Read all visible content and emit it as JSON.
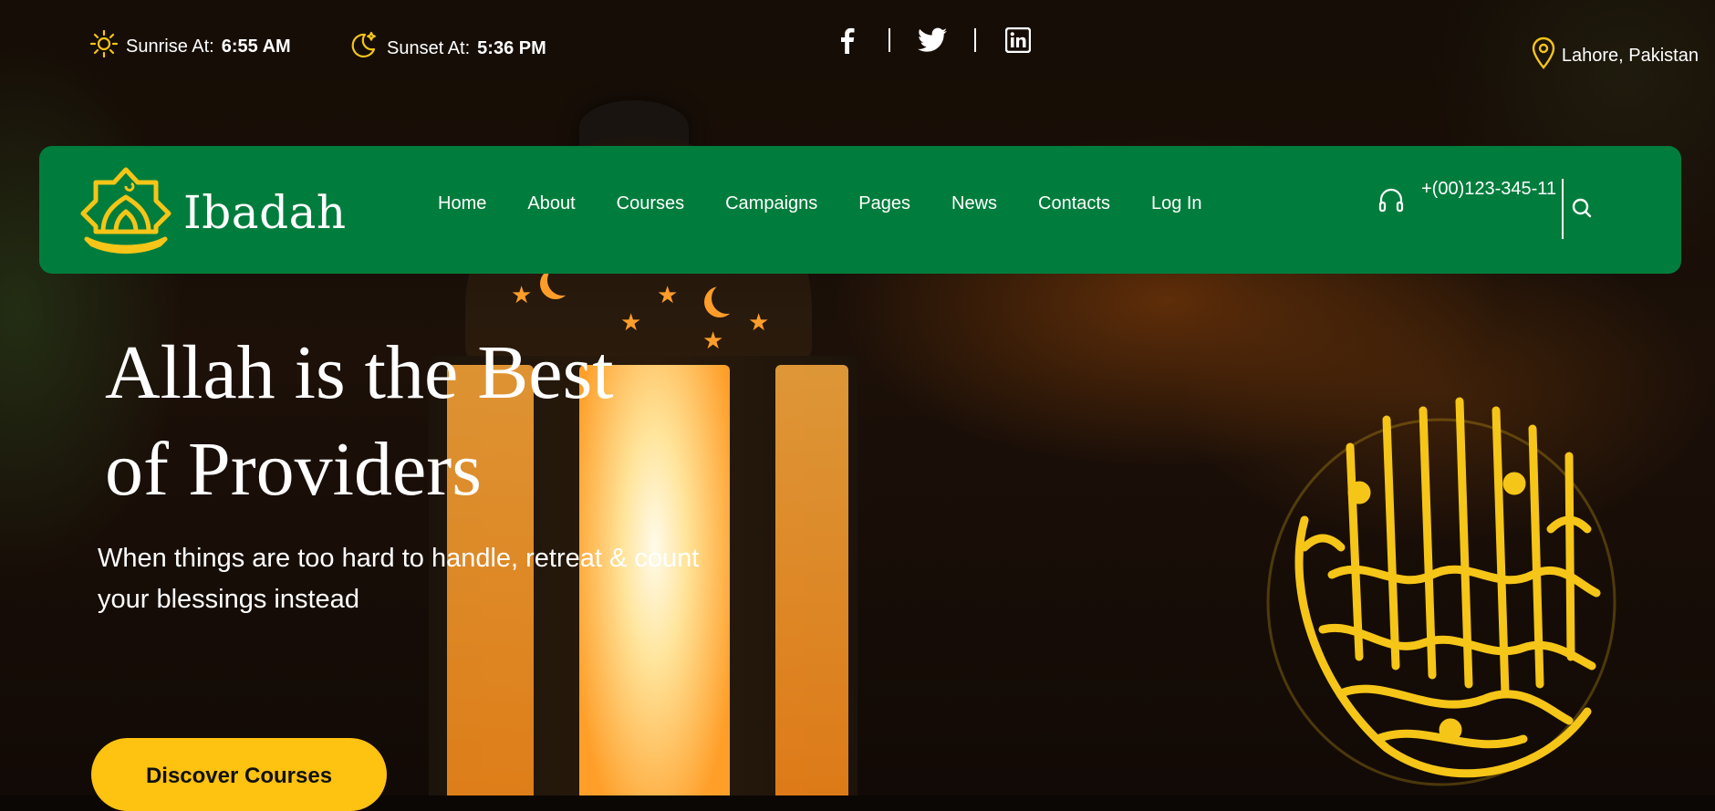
{
  "topbar": {
    "sunrise_label": "Sunrise At:",
    "sunrise_time": "6:55 AM",
    "sunset_label": "Sunset At:",
    "sunset_time": "5:36 PM",
    "social": [
      "facebook-icon",
      "twitter-icon",
      "linkedin-icon"
    ],
    "location": "Lahore, Pakistan"
  },
  "nav": {
    "logo_text": "Ibadah",
    "items": [
      "Home",
      "About",
      "Courses",
      "Campaigns",
      "Pages",
      "News",
      "Contacts",
      "Log In"
    ],
    "phone": "+(00)123-345-11"
  },
  "hero": {
    "title_line1": "Allah is the Best",
    "title_line2": "of Providers",
    "subtitle_line1": "When things are too hard to handle, retreat & count",
    "subtitle_line2": "your blessings instead",
    "cta_label": "Discover Courses"
  },
  "colors": {
    "nav_green": "#007d3c",
    "accent_yellow": "#fec210",
    "icon_gold": "#f5c518"
  }
}
